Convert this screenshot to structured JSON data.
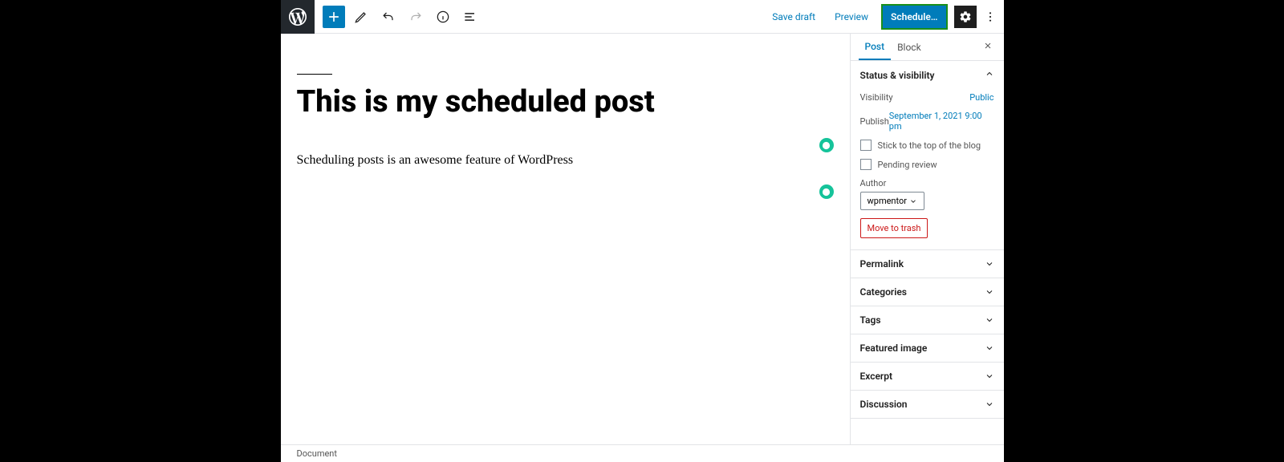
{
  "toolbar": {
    "save_draft": "Save draft",
    "preview": "Preview",
    "schedule": "Schedule…"
  },
  "editor": {
    "title": "This is my scheduled post",
    "paragraph": "Scheduling posts is an awesome feature of WordPress"
  },
  "sidebar": {
    "tabs": {
      "post": "Post",
      "block": "Block"
    },
    "status": {
      "title": "Status & visibility",
      "visibility_label": "Visibility",
      "visibility_value": "Public",
      "publish_label": "Publish",
      "publish_value": "September 1, 2021 9:00 pm",
      "stick_label": "Stick to the top of the blog",
      "pending_label": "Pending review",
      "author_label": "Author",
      "author_value": "wpmentor",
      "trash": "Move to trash"
    },
    "panels": {
      "permalink": "Permalink",
      "categories": "Categories",
      "tags": "Tags",
      "featured": "Featured image",
      "excerpt": "Excerpt",
      "discussion": "Discussion"
    }
  },
  "footer": {
    "breadcrumb": "Document"
  }
}
